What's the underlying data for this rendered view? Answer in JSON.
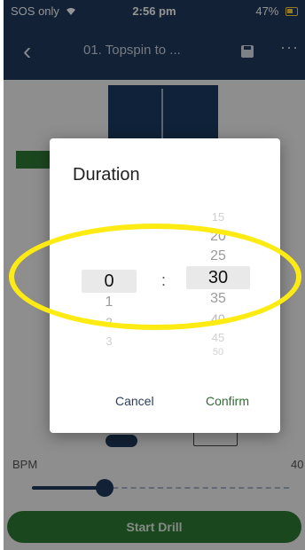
{
  "status_bar": {
    "carrier": "SOS only",
    "time": "2:56 pm",
    "battery": "47%"
  },
  "app_bar": {
    "title": "01. Topspin to ...",
    "back_icon": "chevron-left-icon",
    "save_icon": "save-icon",
    "more_icon": "more-icon"
  },
  "bpm": {
    "label": "BPM",
    "value": "40",
    "slider_fraction": 0.26
  },
  "start_button": {
    "label": "Start Drill"
  },
  "duration_dialog": {
    "title": "Duration",
    "hours": {
      "items": [
        "1",
        "2",
        "3"
      ],
      "selected": "0"
    },
    "separator": ":",
    "minutes": {
      "above": [
        "15",
        "20",
        "25"
      ],
      "selected": "30",
      "below": [
        "35",
        "40",
        "45",
        "50"
      ]
    },
    "cancel_label": "Cancel",
    "confirm_label": "Confirm"
  },
  "colors": {
    "navy": "#1f3a5c",
    "green": "#2f7a36",
    "highlight_yellow": "#ffeb14"
  }
}
